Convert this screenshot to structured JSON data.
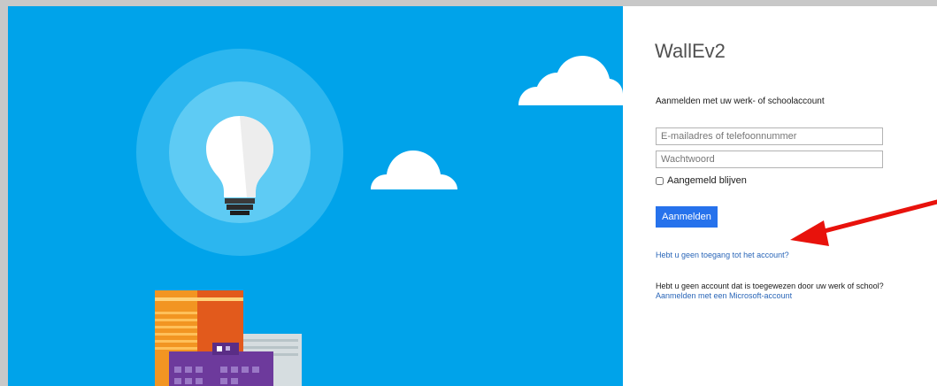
{
  "app": {
    "title": "WallEv2"
  },
  "signin": {
    "heading": "Aanmelden met uw werk- of schoolaccount",
    "email_placeholder": "E-mailadres of telefoonnummer",
    "password_placeholder": "Wachtwoord",
    "remember_label": "Aangemeld blijven",
    "remember_checked": false,
    "submit_label": "Aanmelden",
    "no_access_link": "Hebt u geen toegang tot het account?",
    "no_account_text": "Hebt u geen account dat is toegewezen door uw werk of school?",
    "ms_account_link": "Aanmelden met een Microsoft-account"
  },
  "colors": {
    "hero_background": "#00a3ea",
    "primary_button": "#2672ec",
    "link": "#2a66b8",
    "annotation_arrow": "#e8120c"
  },
  "illustration": {
    "icons": [
      "lightbulb-icon",
      "cloud-icon",
      "city-buildings-icon"
    ]
  }
}
